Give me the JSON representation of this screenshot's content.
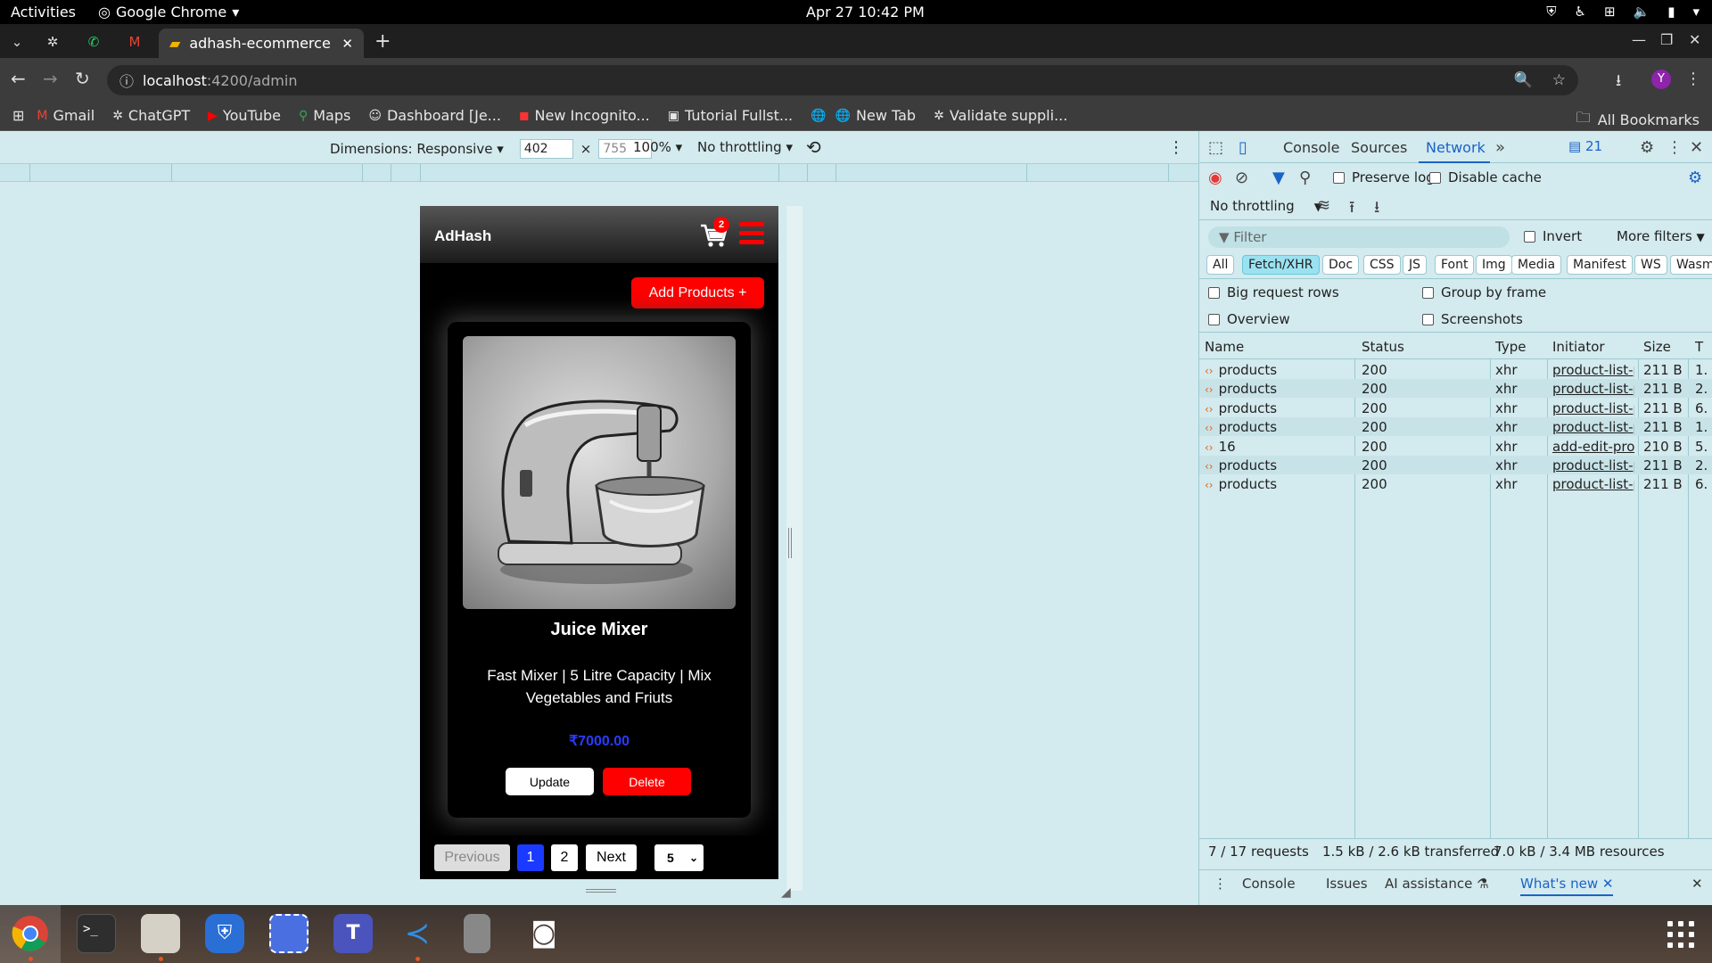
{
  "system": {
    "activities": "Activities",
    "app_name": "Google Chrome",
    "clock": "Apr 27  10:42 PM"
  },
  "browser": {
    "tab_title": "adhash-ecommerce",
    "url_host": "localhost",
    "url_path": ":4200/admin",
    "profile_initial": "Y",
    "bookmarks": [
      "Gmail",
      "ChatGPT",
      "YouTube",
      "Maps",
      "Dashboard [Je...",
      "New Incognito...",
      "Tutorial Fullst...",
      "New Tab",
      "Validate suppli..."
    ],
    "all_bookmarks": "All Bookmarks"
  },
  "emulation": {
    "dimensions_label": "Dimensions: Responsive",
    "width": "402",
    "times": "×",
    "height": "755",
    "zoom": "100%",
    "throttling": "No throttling"
  },
  "app": {
    "brand": "AdHash",
    "cart_count": "2",
    "add_products_label": "Add Products +",
    "product": {
      "name": "Juice Mixer",
      "description": "Fast Mixer | 5 Litre Capacity | Mix Vegetables and Friuts",
      "price": "₹7000.00"
    },
    "update_label": "Update",
    "delete_label": "Delete",
    "pagination": {
      "previous": "Previous",
      "pages": [
        "1",
        "2"
      ],
      "next": "Next",
      "page_size": "5"
    },
    "colors": {
      "accent": "#ff0000",
      "price": "#2b3bff",
      "page_active": "#1a3bff"
    }
  },
  "devtools": {
    "tabs": [
      "Console",
      "Sources",
      "Network"
    ],
    "active_tab": "Network",
    "issues_count": "21",
    "preserve_log": "Preserve log",
    "disable_cache": "Disable cache",
    "throttling": "No throttling",
    "filter_placeholder": "Filter",
    "invert": "Invert",
    "more_filters": "More filters",
    "type_filters": [
      "All",
      "Fetch/XHR",
      "Doc",
      "CSS",
      "JS",
      "Font",
      "Img",
      "Media",
      "Manifest",
      "WS",
      "Wasm"
    ],
    "active_type": "Fetch/XHR",
    "options": [
      "Big request rows",
      "Group by frame",
      "Overview",
      "Screenshots"
    ],
    "columns": [
      "Name",
      "Status",
      "Type",
      "Initiator",
      "Size",
      "T"
    ],
    "requests": [
      {
        "name": "products",
        "status": "200",
        "type": "xhr",
        "initiator": "product-list-pa",
        "size": "211 B",
        "time": "1."
      },
      {
        "name": "products",
        "status": "200",
        "type": "xhr",
        "initiator": "product-list-pa",
        "size": "211 B",
        "time": "2."
      },
      {
        "name": "products",
        "status": "200",
        "type": "xhr",
        "initiator": "product-list-pa",
        "size": "211 B",
        "time": "6."
      },
      {
        "name": "products",
        "status": "200",
        "type": "xhr",
        "initiator": "product-list-pa",
        "size": "211 B",
        "time": "1."
      },
      {
        "name": "16",
        "status": "200",
        "type": "xhr",
        "initiator": "add-edit-produ",
        "size": "210 B",
        "time": "5."
      },
      {
        "name": "products",
        "status": "200",
        "type": "xhr",
        "initiator": "product-list-pa",
        "size": "211 B",
        "time": "2."
      },
      {
        "name": "products",
        "status": "200",
        "type": "xhr",
        "initiator": "product-list-pa",
        "size": "211 B",
        "time": "6."
      }
    ],
    "summary": {
      "requests": "7 / 17 requests",
      "transferred": "1.5 kB / 2.6 kB transferred",
      "resources": "7.0 kB / 3.4 MB resources"
    },
    "drawer_tabs": [
      "Console",
      "Issues",
      "AI assistance",
      "What's new"
    ]
  }
}
